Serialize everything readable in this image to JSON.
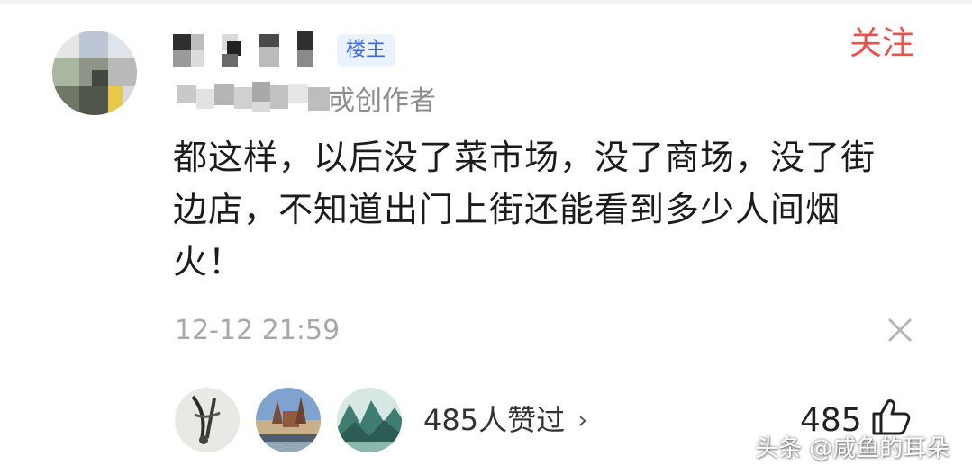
{
  "post": {
    "badge": "楼主",
    "follow_label": "关注",
    "author_tag": "戓创作者",
    "comment_text": "都这样，以后没了菜市场，没了商场，没了街边店，不知道出门上街还能看到多少人间烟火！",
    "timestamp": "12-12 21:59"
  },
  "likes": {
    "summary": "485人赞过",
    "chevron": "›",
    "count": "485"
  },
  "watermark": "头条 @咸鱼的耳朵",
  "colors": {
    "follow": "#e9524e",
    "badge_text": "#3d6bd6",
    "badge_bg": "#eaf1ff",
    "meta_text": "#a8a8a8"
  },
  "icons": [
    "close-icon",
    "thumbs-up-icon",
    "chevron-right-icon"
  ]
}
